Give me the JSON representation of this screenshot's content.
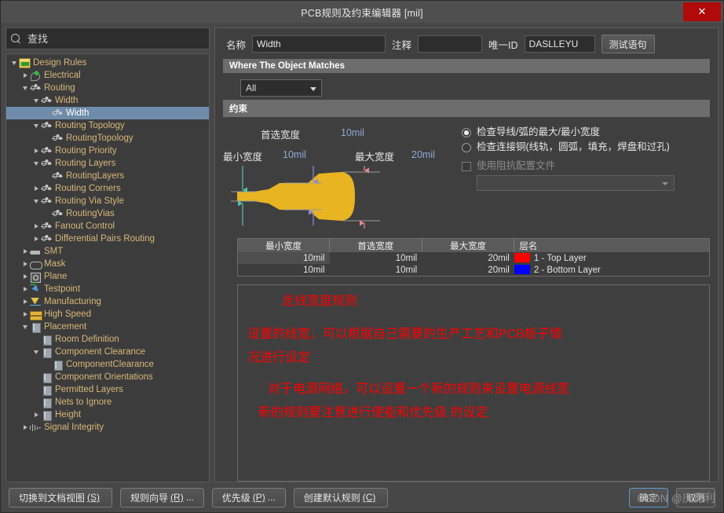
{
  "window": {
    "title": "PCB规则及约束编辑器 [mil]",
    "close_label": "✕"
  },
  "sidebar": {
    "search_placeholder": "查找",
    "search_value": "",
    "tree": [
      {
        "label": "Design Rules",
        "depth": 0,
        "arrow": "expanded",
        "icon": "folder-icon",
        "selected": false
      },
      {
        "label": "Electrical",
        "depth": 1,
        "arrow": "collapsed",
        "icon": "electrical-icon",
        "selected": false
      },
      {
        "label": "Routing",
        "depth": 1,
        "arrow": "expanded",
        "icon": "routing-icon",
        "selected": false
      },
      {
        "label": "Width",
        "depth": 2,
        "arrow": "expanded",
        "icon": "routing-icon",
        "selected": false
      },
      {
        "label": "Width",
        "depth": 3,
        "arrow": "none",
        "icon": "routing-icon",
        "selected": true
      },
      {
        "label": "Routing Topology",
        "depth": 2,
        "arrow": "expanded",
        "icon": "routing-icon",
        "selected": false
      },
      {
        "label": "RoutingTopology",
        "depth": 3,
        "arrow": "none",
        "icon": "routing-icon",
        "selected": false
      },
      {
        "label": "Routing Priority",
        "depth": 2,
        "arrow": "collapsed",
        "icon": "routing-icon",
        "selected": false
      },
      {
        "label": "Routing Layers",
        "depth": 2,
        "arrow": "expanded",
        "icon": "routing-icon",
        "selected": false
      },
      {
        "label": "RoutingLayers",
        "depth": 3,
        "arrow": "none",
        "icon": "routing-icon",
        "selected": false
      },
      {
        "label": "Routing Corners",
        "depth": 2,
        "arrow": "collapsed",
        "icon": "routing-icon",
        "selected": false
      },
      {
        "label": "Routing Via Style",
        "depth": 2,
        "arrow": "expanded",
        "icon": "routing-icon",
        "selected": false
      },
      {
        "label": "RoutingVias",
        "depth": 3,
        "arrow": "none",
        "icon": "routing-icon",
        "selected": false
      },
      {
        "label": "Fanout Control",
        "depth": 2,
        "arrow": "collapsed",
        "icon": "routing-icon",
        "selected": false
      },
      {
        "label": "Differential Pairs Routing",
        "depth": 2,
        "arrow": "collapsed",
        "icon": "routing-icon",
        "selected": false
      },
      {
        "label": "SMT",
        "depth": 1,
        "arrow": "collapsed",
        "icon": "smt-icon",
        "selected": false
      },
      {
        "label": "Mask",
        "depth": 1,
        "arrow": "collapsed",
        "icon": "mask-icon",
        "selected": false
      },
      {
        "label": "Plane",
        "depth": 1,
        "arrow": "collapsed",
        "icon": "plane-icon",
        "selected": false
      },
      {
        "label": "Testpoint",
        "depth": 1,
        "arrow": "collapsed",
        "icon": "testpoint-icon",
        "selected": false
      },
      {
        "label": "Manufacturing",
        "depth": 1,
        "arrow": "collapsed",
        "icon": "manufacturing-icon",
        "selected": false
      },
      {
        "label": "High Speed",
        "depth": 1,
        "arrow": "collapsed",
        "icon": "highspeed-icon",
        "selected": false
      },
      {
        "label": "Placement",
        "depth": 1,
        "arrow": "expanded",
        "icon": "placement-icon",
        "selected": false
      },
      {
        "label": "Room Definition",
        "depth": 2,
        "arrow": "none",
        "icon": "placement-icon",
        "selected": false
      },
      {
        "label": "Component Clearance",
        "depth": 2,
        "arrow": "expanded",
        "icon": "placement-icon",
        "selected": false
      },
      {
        "label": "ComponentClearance",
        "depth": 3,
        "arrow": "none",
        "icon": "placement-icon",
        "selected": false
      },
      {
        "label": "Component Orientations",
        "depth": 2,
        "arrow": "none",
        "icon": "placement-icon",
        "selected": false
      },
      {
        "label": "Permitted Layers",
        "depth": 2,
        "arrow": "none",
        "icon": "placement-icon",
        "selected": false
      },
      {
        "label": "Nets to Ignore",
        "depth": 2,
        "arrow": "none",
        "icon": "placement-icon",
        "selected": false
      },
      {
        "label": "Height",
        "depth": 2,
        "arrow": "collapsed",
        "icon": "placement-icon",
        "selected": false
      },
      {
        "label": "Signal Integrity",
        "depth": 1,
        "arrow": "collapsed",
        "icon": "signal-integrity-icon",
        "selected": false
      }
    ]
  },
  "form": {
    "name_label": "名称",
    "name_value": "Width",
    "comment_label": "注释",
    "comment_value": "",
    "uid_label": "唯一ID",
    "uid_value": "DASLLEYU",
    "test_query_label": "测试语句"
  },
  "match": {
    "section_title": "Where The Object Matches",
    "scope_value": "All",
    "scope_options": [
      "All"
    ]
  },
  "constraint": {
    "section_title": "约束",
    "graphic": {
      "preferred_label": "首选宽度",
      "preferred_value": "10mil",
      "min_label": "最小宽度",
      "min_value": "10mil",
      "max_label": "最大宽度",
      "max_value": "20mil",
      "trace_color": "#e8b422",
      "min_arrow_color": "#4fc3b0",
      "pref_arrow_color": "#8f8ad6",
      "max_arrow_color": "#e08a8a"
    },
    "options": {
      "radio_track_arc": "检查导线/弧的最大/最小宽度",
      "radio_track_arc_selected": true,
      "radio_connected_copper": "检查连接铜(线轨，圆弧，填充，焊盘和过孔)",
      "radio_connected_copper_selected": false,
      "checkbox_impedance": "使用阻抗配置文件",
      "checkbox_impedance_checked": false,
      "impedance_profile_value": ""
    }
  },
  "table": {
    "headers": [
      "最小宽度",
      "首选宽度",
      "最大宽度",
      "层名"
    ],
    "rows": [
      {
        "min": "10mil",
        "preferred": "10mil",
        "max": "20mil",
        "layer": "1 - Top Layer",
        "swatch": "#ff0000"
      },
      {
        "min": "10mil",
        "preferred": "10mil",
        "max": "20mil",
        "layer": "2 - Bottom Layer",
        "swatch": "#0000ff"
      }
    ]
  },
  "notes": {
    "color": "#ff0000",
    "line1": "走线宽度规则",
    "line2": "设置的线宽，可以根据自己需要的生产工艺和PCB板子情",
    "line3": "况进行设定",
    "line4": "对于电源网络，可以设置一个新的规则来设置电源线宽",
    "line5": "新的规则要注意进行使能和优先级 的设定"
  },
  "footer": {
    "buttons": [
      {
        "text": "切换到文档视图 ",
        "accel": "(S)",
        "suffix": "",
        "primary": false
      },
      {
        "text": "规则向导 ",
        "accel": "(R)",
        "suffix": "...",
        "primary": false
      },
      {
        "text": "优先级 ",
        "accel": "(P)",
        "suffix": "...",
        "primary": false
      },
      {
        "text": "创建默认规则 ",
        "accel": "(C)",
        "suffix": "",
        "primary": false
      }
    ],
    "ok_label": "确定",
    "cancel_label": "取消",
    "watermark": "CSDN @庆再利"
  }
}
